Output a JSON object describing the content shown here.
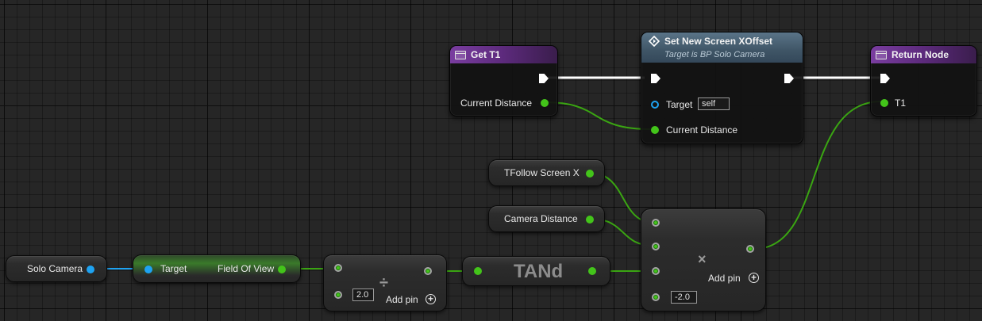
{
  "graph": {
    "nodes": {
      "get_t1": {
        "title": "Get T1",
        "output_label": "Current Distance"
      },
      "set_offset": {
        "title": "Set New Screen XOffset",
        "subtitle": "Target is BP Solo Camera",
        "target_label": "Target",
        "target_value": "self",
        "input_label": "Current Distance"
      },
      "return_node": {
        "title": "Return Node",
        "input_label": "T1"
      },
      "tfollow": {
        "label": "TFollow Screen X"
      },
      "camera_distance": {
        "label": "Camera Distance"
      },
      "solo_camera": {
        "label": "Solo Camera"
      },
      "fov_getter": {
        "target_label": "Target",
        "output_label": "Field Of View"
      },
      "divide": {
        "symbol": "÷",
        "default_value": "2.0",
        "add_pin_label": "Add pin"
      },
      "tand": {
        "title": "TANd"
      },
      "multiply": {
        "symbol": "×",
        "default_value": "-2.0",
        "add_pin_label": "Add pin"
      }
    }
  },
  "colors": {
    "float_pin": "#43c41a",
    "object_pin": "#1ea3f2",
    "exec_pin": "#ffffff",
    "function_header": "#7a3da0"
  },
  "icons": [
    "function-icon",
    "event-diamond-icon",
    "add-pin-icon"
  ]
}
